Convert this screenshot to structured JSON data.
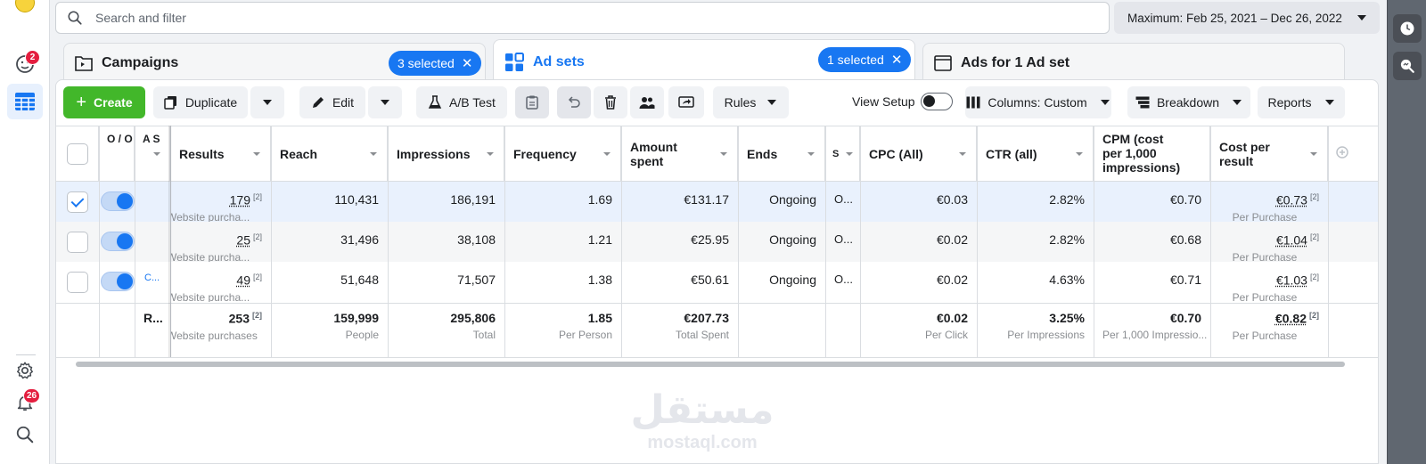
{
  "rail": {
    "notifications_badge": "2",
    "alerts_badge": "26"
  },
  "search": {
    "placeholder": "Search and filter"
  },
  "date_range": {
    "label": "Maximum: Feb 25, 2021 – Dec 26, 2022"
  },
  "tabs": {
    "campaigns": {
      "label": "Campaigns",
      "pill": "3 selected"
    },
    "adsets": {
      "label": "Ad sets",
      "pill": "1 selected"
    },
    "ads": {
      "label": "Ads for 1 Ad set"
    }
  },
  "toolbar": {
    "create": "Create",
    "duplicate": "Duplicate",
    "edit": "Edit",
    "ab_test": "A/B Test",
    "rules": "Rules",
    "view_setup": "View Setup",
    "columns": "Columns: Custom",
    "breakdown": "Breakdown",
    "reports": "Reports"
  },
  "table": {
    "headers": {
      "offon": "O / O",
      "adset": "A S",
      "results": "Results",
      "reach": "Reach",
      "impressions": "Impressions",
      "frequency": "Frequency",
      "amount_spent": "Amount spent",
      "ends": "Ends",
      "s": "S",
      "cpc": "CPC (All)",
      "ctr": "CTR (all)",
      "cpm": "CPM (cost per 1,000 impressions)",
      "cost_per_result": "Cost per result"
    },
    "rows": [
      {
        "checked": true,
        "adset": "",
        "results": "179",
        "results_sup": "[2]",
        "results_sub": "Website purcha...",
        "reach": "110,431",
        "impressions": "186,191",
        "frequency": "1.69",
        "amount_spent": "€131.17",
        "ends": "Ongoing",
        "s": "O...",
        "cpc": "€0.03",
        "ctr": "2.82%",
        "cpm": "€0.70",
        "cpr": "€0.73",
        "cpr_sup": "[2]",
        "cpr_sub": "Per Purchase"
      },
      {
        "checked": false,
        "adset": "",
        "results": "25",
        "results_sup": "[2]",
        "results_sub": "Website purcha...",
        "reach": "31,496",
        "impressions": "38,108",
        "frequency": "1.21",
        "amount_spent": "€25.95",
        "ends": "Ongoing",
        "s": "O...",
        "cpc": "€0.02",
        "ctr": "2.82%",
        "cpm": "€0.68",
        "cpr": "€1.04",
        "cpr_sup": "[2]",
        "cpr_sub": "Per Purchase"
      },
      {
        "checked": false,
        "adset": "C...",
        "results": "49",
        "results_sup": "[2]",
        "results_sub": "Website purcha...",
        "reach": "51,648",
        "impressions": "71,507",
        "frequency": "1.38",
        "amount_spent": "€50.61",
        "ends": "Ongoing",
        "s": "O...",
        "cpc": "€0.02",
        "ctr": "4.63%",
        "cpm": "€0.71",
        "cpr": "€1.03",
        "cpr_sup": "[2]",
        "cpr_sub": "Per Purchase"
      }
    ],
    "totals": {
      "label": "R...",
      "results": "253",
      "results_sup": "[2]",
      "results_sub": "Website purchases",
      "reach": "159,999",
      "reach_sub": "People",
      "impressions": "295,806",
      "impressions_sub": "Total",
      "frequency": "1.85",
      "frequency_sub": "Per Person",
      "amount_spent": "€207.73",
      "amount_spent_sub": "Total Spent",
      "cpc": "€0.02",
      "cpc_sub": "Per Click",
      "ctr": "3.25%",
      "ctr_sub": "Per Impressions",
      "cpm": "€0.70",
      "cpm_sub": "Per 1,000 Impressio...",
      "cpr": "€0.82",
      "cpr_sup": "[2]",
      "cpr_sub": "Per Purchase"
    }
  },
  "watermark": {
    "arabic": "مستقل",
    "latin": "mostaql.com"
  },
  "colors": {
    "accent": "#1877f2",
    "create": "#42b72a",
    "badge": "#e41e3f"
  }
}
